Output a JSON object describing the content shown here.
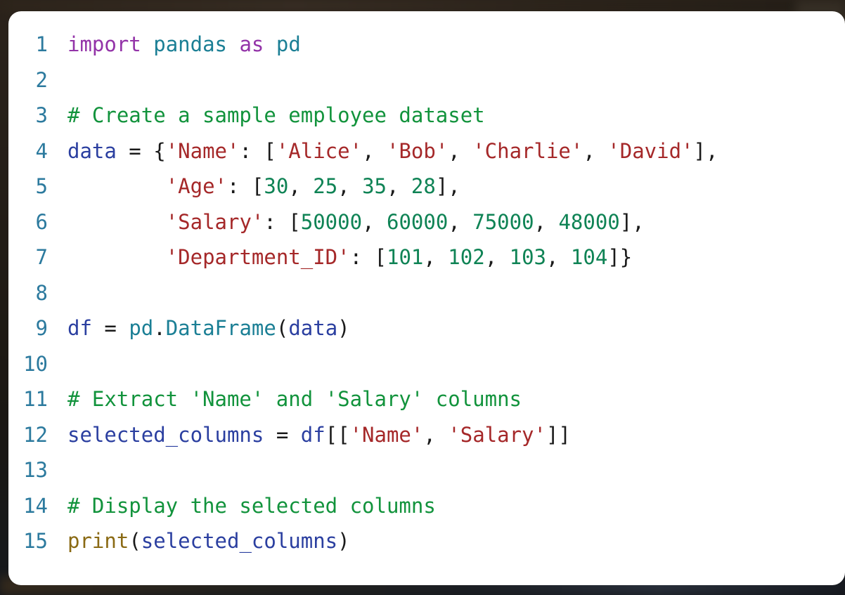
{
  "window": {
    "kind": "code-snippet-card",
    "background_color": "#1e1812",
    "card_background": "#ffffff"
  },
  "editor": {
    "language": "python",
    "gutter_color": "#2c7a9e",
    "first_line_number": 1,
    "last_line_number": 15,
    "total_lines": 15,
    "theme_colors": {
      "keyword": "#9333a8",
      "module": "#1b7f95",
      "identifier": "#2b3fa0",
      "punctuation": "#1a1a1a",
      "string": "#a52829",
      "number": "#0f8355",
      "comment": "#12933c",
      "builtin": "#8a6a14"
    }
  },
  "code": {
    "lines": [
      {
        "number": "1",
        "plain": "import pandas as pd",
        "tokens": [
          {
            "text": "import",
            "type": "t-kw"
          },
          {
            "text": " ",
            "type": "t-plain"
          },
          {
            "text": "pandas",
            "type": "t-mod"
          },
          {
            "text": " ",
            "type": "t-plain"
          },
          {
            "text": "as",
            "type": "t-kw"
          },
          {
            "text": " ",
            "type": "t-plain"
          },
          {
            "text": "pd",
            "type": "t-mod"
          }
        ]
      },
      {
        "number": "2",
        "plain": "",
        "tokens": []
      },
      {
        "number": "3",
        "plain": "# Create a sample employee dataset",
        "tokens": [
          {
            "text": "# Create a sample employee dataset",
            "type": "t-comment"
          }
        ]
      },
      {
        "number": "4",
        "plain": "data = {'Name': ['Alice', 'Bob', 'Charlie', 'David'],",
        "tokens": [
          {
            "text": "data",
            "type": "t-name"
          },
          {
            "text": " = {",
            "type": "t-plain"
          },
          {
            "text": "'Name'",
            "type": "t-str"
          },
          {
            "text": ": [",
            "type": "t-plain"
          },
          {
            "text": "'Alice'",
            "type": "t-str"
          },
          {
            "text": ", ",
            "type": "t-plain"
          },
          {
            "text": "'Bob'",
            "type": "t-str"
          },
          {
            "text": ", ",
            "type": "t-plain"
          },
          {
            "text": "'Charlie'",
            "type": "t-str"
          },
          {
            "text": ", ",
            "type": "t-plain"
          },
          {
            "text": "'David'",
            "type": "t-str"
          },
          {
            "text": "],",
            "type": "t-plain"
          }
        ]
      },
      {
        "number": "5",
        "plain": "        'Age': [30, 25, 35, 28],",
        "tokens": [
          {
            "text": "        ",
            "type": "t-plain"
          },
          {
            "text": "'Age'",
            "type": "t-str"
          },
          {
            "text": ": [",
            "type": "t-plain"
          },
          {
            "text": "30",
            "type": "t-num"
          },
          {
            "text": ", ",
            "type": "t-plain"
          },
          {
            "text": "25",
            "type": "t-num"
          },
          {
            "text": ", ",
            "type": "t-plain"
          },
          {
            "text": "35",
            "type": "t-num"
          },
          {
            "text": ", ",
            "type": "t-plain"
          },
          {
            "text": "28",
            "type": "t-num"
          },
          {
            "text": "],",
            "type": "t-plain"
          }
        ]
      },
      {
        "number": "6",
        "plain": "        'Salary': [50000, 60000, 75000, 48000],",
        "tokens": [
          {
            "text": "        ",
            "type": "t-plain"
          },
          {
            "text": "'Salary'",
            "type": "t-str"
          },
          {
            "text": ": [",
            "type": "t-plain"
          },
          {
            "text": "50000",
            "type": "t-num"
          },
          {
            "text": ", ",
            "type": "t-plain"
          },
          {
            "text": "60000",
            "type": "t-num"
          },
          {
            "text": ", ",
            "type": "t-plain"
          },
          {
            "text": "75000",
            "type": "t-num"
          },
          {
            "text": ", ",
            "type": "t-plain"
          },
          {
            "text": "48000",
            "type": "t-num"
          },
          {
            "text": "],",
            "type": "t-plain"
          }
        ]
      },
      {
        "number": "7",
        "plain": "        'Department_ID': [101, 102, 103, 104]}",
        "tokens": [
          {
            "text": "        ",
            "type": "t-plain"
          },
          {
            "text": "'Department_ID'",
            "type": "t-str"
          },
          {
            "text": ": [",
            "type": "t-plain"
          },
          {
            "text": "101",
            "type": "t-num"
          },
          {
            "text": ", ",
            "type": "t-plain"
          },
          {
            "text": "102",
            "type": "t-num"
          },
          {
            "text": ", ",
            "type": "t-plain"
          },
          {
            "text": "103",
            "type": "t-num"
          },
          {
            "text": ", ",
            "type": "t-plain"
          },
          {
            "text": "104",
            "type": "t-num"
          },
          {
            "text": "]}",
            "type": "t-plain"
          }
        ]
      },
      {
        "number": "8",
        "plain": "",
        "tokens": []
      },
      {
        "number": "9",
        "plain": "df = pd.DataFrame(data)",
        "tokens": [
          {
            "text": "df",
            "type": "t-name"
          },
          {
            "text": " = ",
            "type": "t-plain"
          },
          {
            "text": "pd",
            "type": "t-mod"
          },
          {
            "text": ".",
            "type": "t-plain"
          },
          {
            "text": "DataFrame",
            "type": "t-mod"
          },
          {
            "text": "(",
            "type": "t-plain"
          },
          {
            "text": "data",
            "type": "t-name"
          },
          {
            "text": ")",
            "type": "t-plain"
          }
        ]
      },
      {
        "number": "10",
        "plain": "",
        "tokens": []
      },
      {
        "number": "11",
        "plain": "# Extract 'Name' and 'Salary' columns",
        "tokens": [
          {
            "text": "# Extract 'Name' and 'Salary' columns",
            "type": "t-comment"
          }
        ]
      },
      {
        "number": "12",
        "plain": "selected_columns = df[['Name', 'Salary']]",
        "tokens": [
          {
            "text": "selected_columns",
            "type": "t-name"
          },
          {
            "text": " = ",
            "type": "t-plain"
          },
          {
            "text": "df",
            "type": "t-name"
          },
          {
            "text": "[[",
            "type": "t-plain"
          },
          {
            "text": "'Name'",
            "type": "t-str"
          },
          {
            "text": ", ",
            "type": "t-plain"
          },
          {
            "text": "'Salary'",
            "type": "t-str"
          },
          {
            "text": "]]",
            "type": "t-plain"
          }
        ]
      },
      {
        "number": "13",
        "plain": "",
        "tokens": []
      },
      {
        "number": "14",
        "plain": "# Display the selected columns",
        "tokens": [
          {
            "text": "# Display the selected columns",
            "type": "t-comment"
          }
        ]
      },
      {
        "number": "15",
        "plain": "print(selected_columns)",
        "tokens": [
          {
            "text": "print",
            "type": "t-builtin"
          },
          {
            "text": "(",
            "type": "t-plain"
          },
          {
            "text": "selected_columns",
            "type": "t-name"
          },
          {
            "text": ")",
            "type": "t-plain"
          }
        ]
      }
    ]
  }
}
